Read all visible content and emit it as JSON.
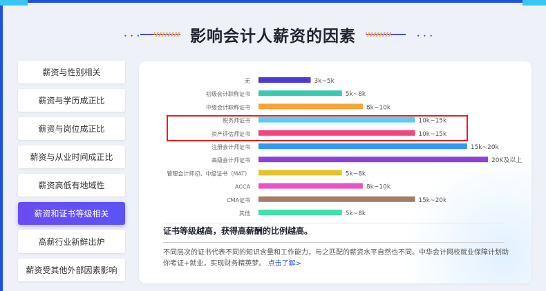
{
  "title": "影响会计人薪资的因素",
  "sidebar": {
    "items": [
      {
        "label": "薪资与性别相关"
      },
      {
        "label": "薪资与学历成正比"
      },
      {
        "label": "薪资与岗位成正比"
      },
      {
        "label": "薪资与从业时间成正比"
      },
      {
        "label": "薪资高低有地域性"
      },
      {
        "label": "薪资和证书等级相关"
      },
      {
        "label": "高薪行业新鲜出炉"
      },
      {
        "label": "薪资受其他外部因素影响"
      }
    ],
    "active_index": 5
  },
  "colors": {
    "accent": "#6a4cf0",
    "highlight": "#e02020",
    "link": "#2a58e6"
  },
  "chart_data": {
    "type": "bar",
    "orientation": "horizontal",
    "categories": [
      "无",
      "初级会计职称证书",
      "中级会计职称证书",
      "税务师证书",
      "资产评估师证书",
      "注册会计师证书",
      "高级会计师证书",
      "管理会计师初、中级证书（MAT）",
      "ACCA",
      "CMA证书",
      "其他"
    ],
    "values": [
      5,
      8,
      10,
      15,
      15,
      20,
      22,
      8,
      10,
      15,
      8
    ],
    "labels": [
      "3k~5k",
      "5k~8k",
      "8k~10k",
      "10k~15k",
      "10k~15k",
      "15k~20k",
      "20K及以上",
      "5k~8k",
      "8k~10k",
      "15k~20k",
      "5k~8k"
    ],
    "colors": [
      "#4b3bd6",
      "#3ac9b0",
      "#f8a33a",
      "#5bcdf5",
      "#f0457f",
      "#2f9af0",
      "#8b43d6",
      "#e8c22c",
      "#ea52c8",
      "#a37d66",
      "#40e0a8"
    ],
    "ylim": [
      0,
      22
    ],
    "highlighted": [
      "税务师证书",
      "资产评估师证书"
    ]
  },
  "subtitle": "证书等级越高，获得高薪酬的比例越高。",
  "description": "不同层次的证书代表不同的知识含量和工作能力，与之匹配的薪资水平自然也不同。中华会计网校就业保障计划助你考证+就业，实现财务精英梦。",
  "link_text": "点击了解>"
}
